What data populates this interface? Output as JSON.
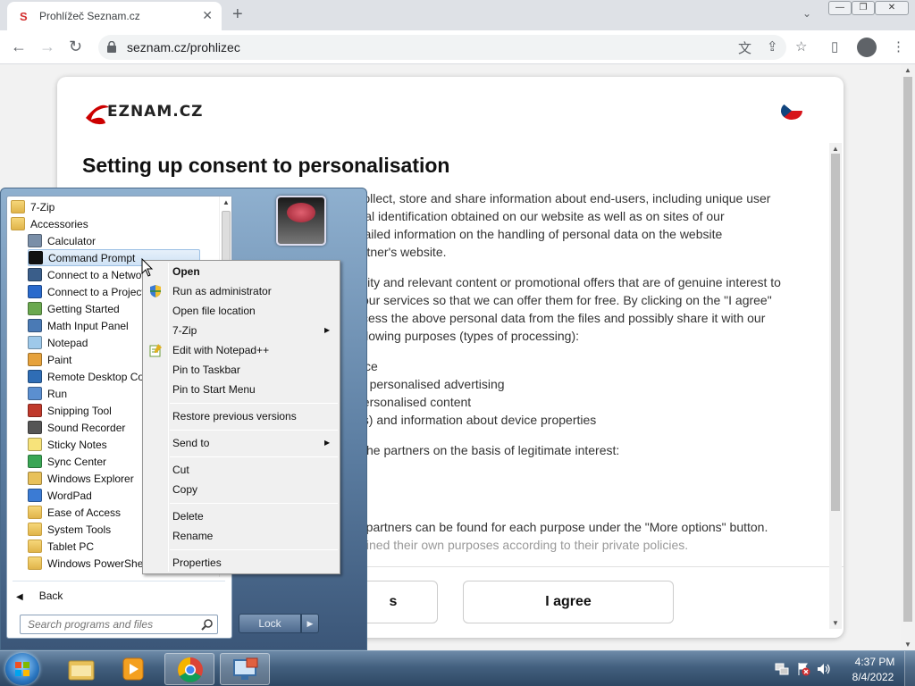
{
  "browser": {
    "tab_title": "Prohlížeč Seznam.cz",
    "tab_favicon": "S",
    "url": "seznam.cz/prohlizec"
  },
  "page": {
    "logo_text": "SEZNAM.CZ",
    "heading": "Setting up consent to personalisation",
    "paragraphs": [
      "The operator of this website and Seznam.cz, a.s. collect, store and share information about end-users, including unique user",
      "ng personal identification obtained on our website as well as on sites of our",
      "detailed information on the handling of personal data on the website",
      "artner's website.",
      "lity and relevant content or promotional offers that are of genuine interest to",
      "our services so that we can offer them for free. By clicking on the \"I agree\"",
      "cess the above personal data from the files and possibly share it with our",
      "llowing purposes (types of processing):",
      "ce",
      "of personalised advertising",
      "personalised content",
      "es) and information about device properties",
      "he partners on the basis of legitimate interest:",
      "d partners can be found for each purpose under the \"More options\" button.",
      "fined their own purposes according to their private policies."
    ],
    "link_text": "the website",
    "button_more": "s",
    "button_agree": "I agree"
  },
  "startmenu": {
    "programs": [
      {
        "label": "7-Zip",
        "type": "folder"
      },
      {
        "label": "Accessories",
        "type": "folder"
      },
      {
        "label": "Calculator",
        "type": "app",
        "icon": "calculator-icon",
        "color": "#7a8fa8"
      },
      {
        "label": "Command Prompt",
        "type": "app",
        "icon": "command-prompt-icon",
        "color": "#111111"
      },
      {
        "label": "Connect to a Network Projector",
        "type": "app",
        "icon": "network-projector-icon",
        "color": "#3a5e8a"
      },
      {
        "label": "Connect to a Projector",
        "type": "app",
        "icon": "projector-icon",
        "color": "#2a6acc"
      },
      {
        "label": "Getting Started",
        "type": "app",
        "icon": "getting-started-icon",
        "color": "#6aa84f"
      },
      {
        "label": "Math Input Panel",
        "type": "app",
        "icon": "math-input-icon",
        "color": "#4a7ab5"
      },
      {
        "label": "Notepad",
        "type": "app",
        "icon": "notepad-icon",
        "color": "#9ec9ea"
      },
      {
        "label": "Paint",
        "type": "app",
        "icon": "paint-icon",
        "color": "#e6a23c"
      },
      {
        "label": "Remote Desktop Connection",
        "type": "app",
        "icon": "remote-desktop-icon",
        "color": "#2f6db5"
      },
      {
        "label": "Run",
        "type": "app",
        "icon": "run-icon",
        "color": "#5b8fd0"
      },
      {
        "label": "Snipping Tool",
        "type": "app",
        "icon": "snipping-tool-icon",
        "color": "#c0392b"
      },
      {
        "label": "Sound Recorder",
        "type": "app",
        "icon": "sound-recorder-icon",
        "color": "#555555"
      },
      {
        "label": "Sticky Notes",
        "type": "app",
        "icon": "sticky-notes-icon",
        "color": "#f7e37a"
      },
      {
        "label": "Sync Center",
        "type": "app",
        "icon": "sync-center-icon",
        "color": "#3aa655"
      },
      {
        "label": "Windows Explorer",
        "type": "app",
        "icon": "windows-explorer-icon",
        "color": "#e8c15a"
      },
      {
        "label": "WordPad",
        "type": "app",
        "icon": "wordpad-icon",
        "color": "#3b7bd4"
      },
      {
        "label": "Ease of Access",
        "type": "folder"
      },
      {
        "label": "System Tools",
        "type": "folder"
      },
      {
        "label": "Tablet PC",
        "type": "folder"
      },
      {
        "label": "Windows PowerShell",
        "type": "folder"
      }
    ],
    "highlighted": "Command Prompt",
    "back_label": "Back",
    "search_placeholder": "Search programs and files",
    "lock_label": "Lock"
  },
  "context_menu": {
    "items": [
      {
        "label": "Open",
        "bold": true
      },
      {
        "label": "Run as administrator",
        "icon": "uac-shield-icon"
      },
      {
        "label": "Open file location"
      },
      {
        "label": "7-Zip",
        "submenu": true
      },
      {
        "label": "Edit with Notepad++",
        "icon": "notepad-plus-plus-icon"
      },
      {
        "label": "Pin to Taskbar"
      },
      {
        "label": "Pin to Start Menu"
      },
      {
        "label": "Restore previous versions"
      },
      {
        "label": "Send to",
        "submenu": true
      },
      {
        "label": "Cut"
      },
      {
        "label": "Copy"
      },
      {
        "label": "Delete"
      },
      {
        "label": "Rename"
      },
      {
        "label": "Properties"
      }
    ]
  },
  "taskbar": {
    "time": "4:37 PM",
    "date": "8/4/2022"
  },
  "colors": {
    "chrome_tab_bg": "#dee1e6",
    "seznam_red": "#cc0000",
    "taskbar": "#43607f"
  }
}
